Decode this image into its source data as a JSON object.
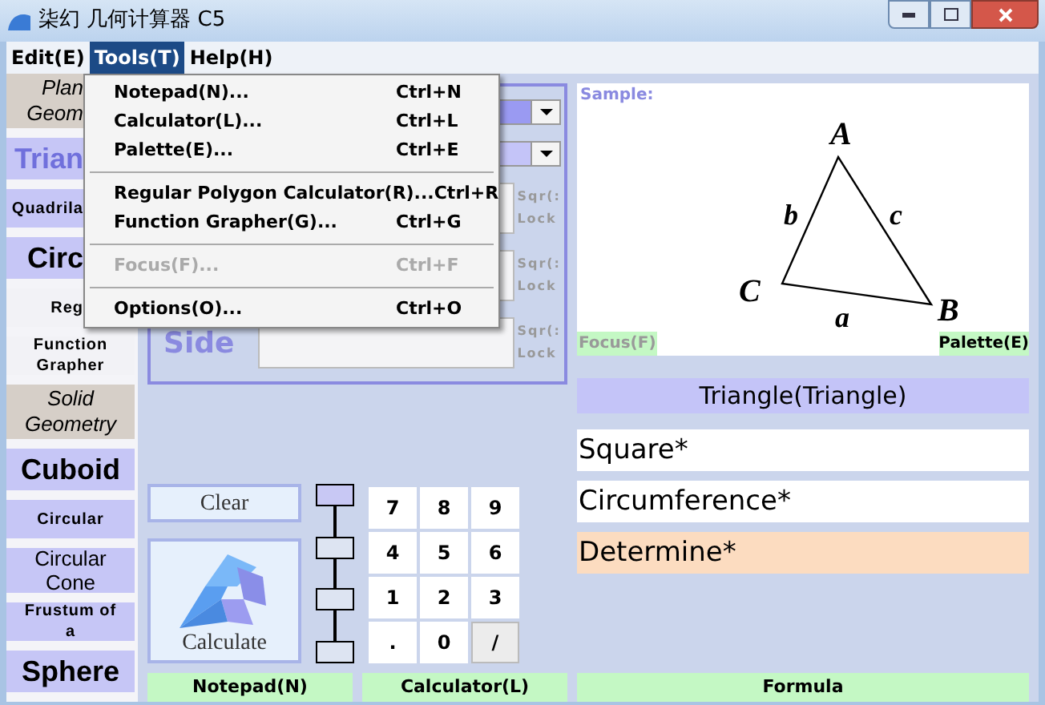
{
  "window": {
    "title": "柒幻 几何计算器 C5"
  },
  "menu_bar": [
    {
      "label": "Edit(E)",
      "selected": false
    },
    {
      "label": "Tools(T)",
      "selected": true
    },
    {
      "label": "Help(H)",
      "selected": false
    }
  ],
  "tools_menu": [
    {
      "kind": "item",
      "label": "Notepad(N)...",
      "shortcut": "Ctrl+N",
      "disabled": false
    },
    {
      "kind": "item",
      "label": "Calculator(L)...",
      "shortcut": "Ctrl+L",
      "disabled": false
    },
    {
      "kind": "item",
      "label": "Palette(E)...",
      "shortcut": "Ctrl+E",
      "disabled": false
    },
    {
      "kind": "separator"
    },
    {
      "kind": "item",
      "label": "Regular Polygon Calculator(R)...",
      "shortcut": "Ctrl+R",
      "disabled": false
    },
    {
      "kind": "item",
      "label": "Function Grapher(G)...",
      "shortcut": "Ctrl+G",
      "disabled": false
    },
    {
      "kind": "separator"
    },
    {
      "kind": "item",
      "label": "Focus(F)...",
      "shortcut": "Ctrl+F",
      "disabled": true
    },
    {
      "kind": "separator"
    },
    {
      "kind": "item",
      "label": "Options(O)...",
      "shortcut": "Ctrl+O",
      "disabled": false
    }
  ],
  "sidebar": [
    {
      "kind": "header",
      "lines": [
        "Plan",
        "Geom"
      ],
      "selected": false,
      "clipped": true
    },
    {
      "kind": "large",
      "lines": [
        "Trian"
      ],
      "selected": true,
      "clipped": true
    },
    {
      "kind": "small",
      "lines": [
        "Quadrila"
      ],
      "selected": false,
      "clipped": true
    },
    {
      "kind": "large",
      "lines": [
        "Circ"
      ],
      "selected": false,
      "clipped": true
    },
    {
      "kind": "plain",
      "lines": [
        "Reg"
      ],
      "selected": false,
      "clipped": true
    },
    {
      "kind": "plain",
      "lines": [
        "Function",
        "Grapher"
      ],
      "selected": false
    },
    {
      "kind": "header",
      "lines": [
        "Solid",
        "Geometry"
      ],
      "selected": false
    },
    {
      "kind": "large",
      "lines": [
        "Cuboid"
      ],
      "selected": false
    },
    {
      "kind": "small",
      "lines": [
        "Circular"
      ],
      "selected": false
    },
    {
      "kind": "medium",
      "lines": [
        "Circular",
        "Cone"
      ],
      "selected": false
    },
    {
      "kind": "small",
      "lines": [
        "Frustum of",
        "a"
      ],
      "selected": false
    },
    {
      "kind": "large",
      "lines": [
        "Sphere"
      ],
      "selected": false
    }
  ],
  "combos": [
    {
      "color": "#9a9af2"
    },
    {
      "color": "#c4c4f8"
    }
  ],
  "fields": [
    {
      "sqr": "Sqr(:",
      "lock": "Lock"
    },
    {
      "sqr": "Sqr(:",
      "lock": "Lock"
    },
    {
      "label": "Side",
      "sqr": "Sqr(:",
      "lock": "Lock"
    }
  ],
  "sample": {
    "title": "Sample:",
    "vertex_labels": [
      "A",
      "B",
      "C"
    ],
    "side_labels": [
      "a",
      "b",
      "c"
    ],
    "focus": "Focus(F)",
    "palette": "Palette(E)"
  },
  "shape_name": "Triangle(Triangle)",
  "results": [
    {
      "label": "Square*",
      "selected": false
    },
    {
      "label": "Circumference*",
      "selected": false
    },
    {
      "label": "Determine*",
      "selected": true
    }
  ],
  "clear_button": "Clear",
  "calculate_button": "Calculate",
  "ladder": [
    {
      "selected": true
    },
    {
      "selected": false
    },
    {
      "selected": false
    },
    {
      "selected": false
    }
  ],
  "keypad": [
    {
      "label": "7",
      "selected": false
    },
    {
      "label": "8",
      "selected": false
    },
    {
      "label": "9",
      "selected": false
    },
    {
      "label": "4",
      "selected": false
    },
    {
      "label": "5",
      "selected": false
    },
    {
      "label": "6",
      "selected": false
    },
    {
      "label": "1",
      "selected": false
    },
    {
      "label": "2",
      "selected": false
    },
    {
      "label": "3",
      "selected": false
    },
    {
      "label": ".",
      "selected": false
    },
    {
      "label": "0",
      "selected": false
    },
    {
      "label": "/",
      "selected": true
    }
  ],
  "bottom_bar": [
    "Notepad(N)",
    "Calculator(L)",
    "Formula"
  ]
}
